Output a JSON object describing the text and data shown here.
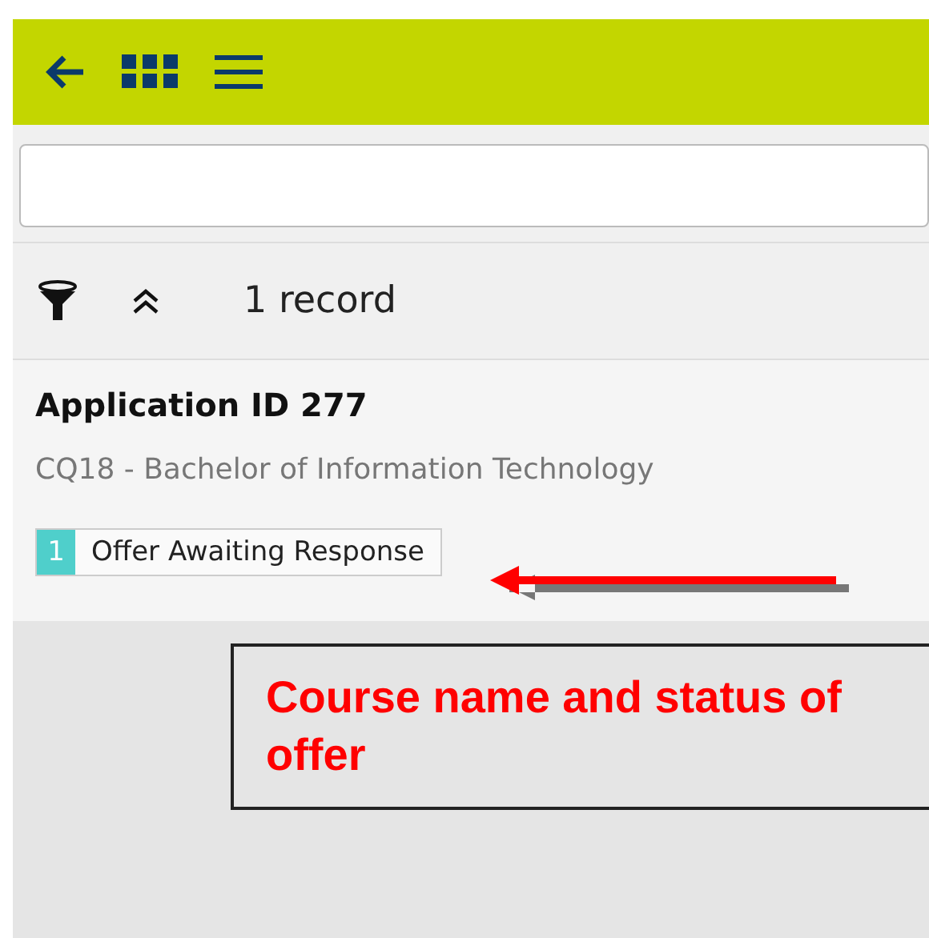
{
  "list_header": {
    "record_count": "1 record"
  },
  "records": [
    {
      "title": "Application ID 277",
      "course": "CQ18 - Bachelor of Information Technology",
      "status": {
        "number": "1",
        "label": "Offer Awaiting Response",
        "color": "#4fcfcb"
      }
    }
  ],
  "annotation": {
    "text": "Course name and status of offer"
  }
}
